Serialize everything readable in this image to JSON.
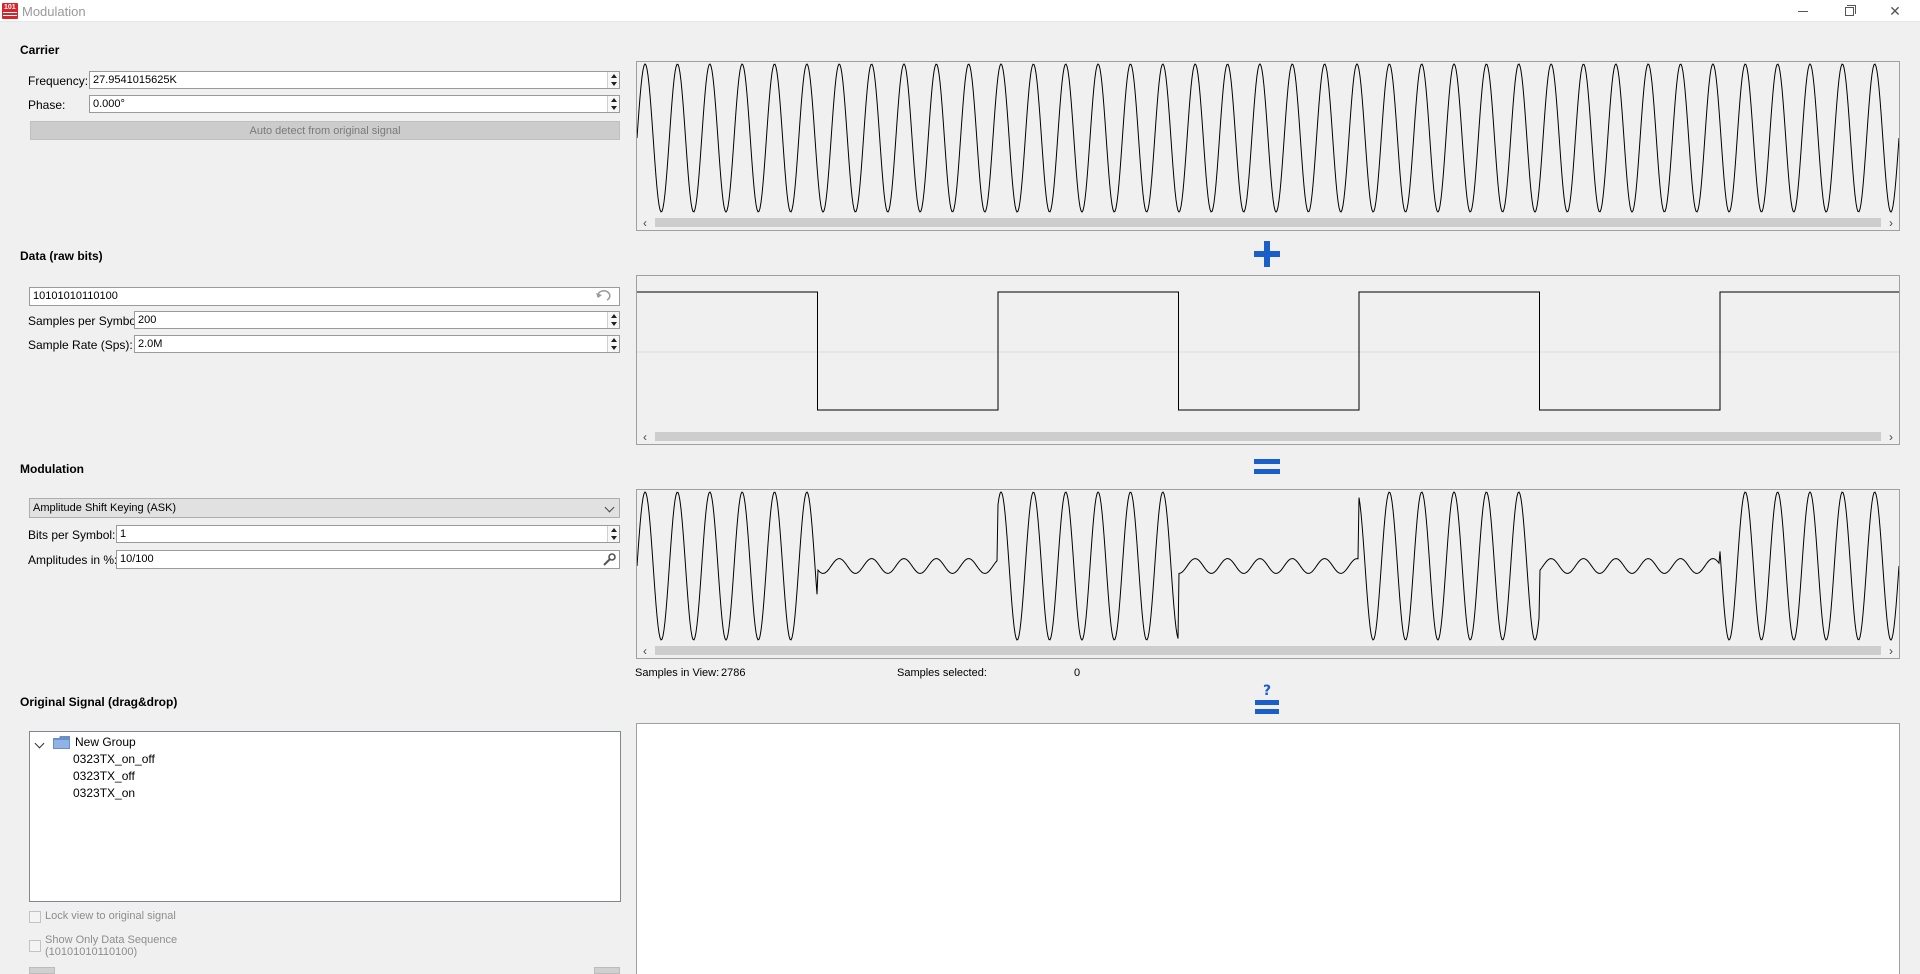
{
  "window": {
    "title": "Modulation",
    "icon": "urh-app-icon"
  },
  "carrier": {
    "section_title": "Carrier",
    "frequency_label": "Frequency:",
    "frequency_value": "27.9541015625K",
    "phase_label": "Phase:",
    "phase_value": "0.000°",
    "auto_detect_label": "Auto detect from original signal"
  },
  "data": {
    "section_title": "Data (raw bits)",
    "bits_value": "10101010110100",
    "samples_per_symbol_label": "Samples per Symbol:",
    "samples_per_symbol_value": "200",
    "sample_rate_label": "Sample Rate (Sps):",
    "sample_rate_value": "2.0M"
  },
  "modulation": {
    "section_title": "Modulation",
    "type_selected": "Amplitude Shift Keying (ASK)",
    "bits_per_symbol_label": "Bits per Symbol:",
    "bits_per_symbol_value": "1",
    "amplitudes_label": "Amplitudes in %:",
    "amplitudes_value": "10/100",
    "samples_in_view_label": "Samples in View:",
    "samples_in_view_value": "2786",
    "samples_selected_label": "Samples selected:",
    "samples_selected_value": "0"
  },
  "operators": {
    "plus": "plus-icon",
    "equals": "equals-icon",
    "question_equals": "question-equals-icon",
    "accent": "#1a5fc9"
  },
  "original": {
    "section_title": "Original Signal (drag&drop)",
    "tree": {
      "group_name": "New Group",
      "items": [
        "0323TX_on_off",
        "0323TX_off",
        "0323TX_on"
      ]
    },
    "lock_view_label": "Lock view to original signal",
    "show_only_label_1": "Show Only Data Sequence",
    "show_only_label_2": "(10101010110100)"
  },
  "signals": {
    "bits": [
      1,
      0,
      1,
      0,
      1,
      0,
      1,
      0,
      1,
      1,
      0,
      1,
      0,
      0
    ],
    "carrier_cycles_visible": 39,
    "ask_low_amplitude_percent": 10,
    "ask_high_amplitude_percent": 100
  }
}
